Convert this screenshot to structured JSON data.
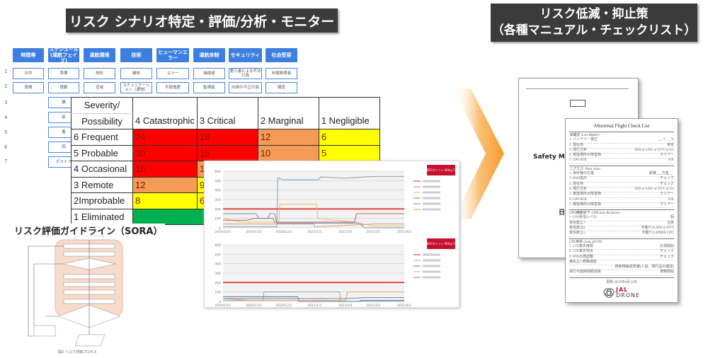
{
  "titles": {
    "left": "リスク シナリオ特定・評価/分析・モニター",
    "right_line1": "リスク低減・抑止策",
    "right_line2": "（各種マニュアル・チェックリスト）"
  },
  "categories": [
    "時間帯",
    "スケジュール\n(運航フェイズ)",
    "運航環境",
    "技術",
    "ヒューマンエラー",
    "運航体制",
    "セキュリティ",
    "社会受容"
  ],
  "row_numbers": [
    "1",
    "2",
    "3",
    "4",
    "5",
    "6",
    "7"
  ],
  "scenario_rows": [
    [
      "日中",
      "準備",
      "地形",
      "機体",
      "エラー",
      "操縦者",
      "第三者による不法行為",
      "利害関係者"
    ],
    [
      "夜間",
      "搭載",
      "空域",
      "コミュニケーション（通信）",
      "手順逸脱",
      "監視者",
      "内部の不正行為",
      "報道"
    ]
  ],
  "schedule_more": [
    "離",
    "巡",
    "着",
    "回",
    "ポストフ"
  ],
  "risk_matrix": {
    "header_top": "Severity/",
    "header_bottom": "Possibility",
    "columns": [
      "4 Catastrophic",
      "3 Critical",
      "2 Marginal",
      "1 Negligible"
    ],
    "rows": [
      {
        "label": "6 Frequent",
        "values": [
          "24",
          "18",
          "12",
          "6"
        ],
        "colors": [
          "#ff0000",
          "#ff0000",
          "#f59a57",
          "#ffff00"
        ]
      },
      {
        "label": "5 Probable",
        "values": [
          "20",
          "15",
          "10",
          "5"
        ],
        "colors": [
          "#ff0000",
          "#ff0000",
          "#f59a57",
          "#ffff00"
        ]
      },
      {
        "label": "4 Occasional",
        "values": [
          "16",
          "12",
          "",
          ""
        ],
        "colors": [
          "#ff0000",
          "#f59a57",
          "#ffffff",
          "#ffffff"
        ]
      },
      {
        "label": "3 Remote",
        "values": [
          "12",
          "9",
          "",
          ""
        ],
        "colors": [
          "#f59a57",
          "#ffff00",
          "#ffffff",
          "#ffffff"
        ]
      },
      {
        "label": "2Improbable",
        "values": [
          "8",
          "6",
          "",
          ""
        ],
        "colors": [
          "#ffff00",
          "#ffff00",
          "#ffffff",
          "#ffffff"
        ]
      },
      {
        "label": "1 Eliminated",
        "values": [
          ""
        ],
        "colors": [
          "#00b050"
        ]
      }
    ]
  },
  "sora": {
    "title": "リスク評価ガイドライン（SORA）",
    "caption": "図2 リスク評価プロセス"
  },
  "chart_data": [
    {
      "type": "line",
      "ylim": [
        0,
        600
      ],
      "yticks": [
        "0",
        "100",
        "200",
        "300",
        "400",
        "500",
        "600"
      ],
      "xticks": [
        "2020/10/1",
        "2020/11/1",
        "2020/12/1",
        "2021/1/1",
        "2021/2/1",
        "2021/3/1",
        "2021/4/1"
      ],
      "grid": true,
      "legend": "right",
      "badge": "ERCポイント 900以下",
      "series": [
        {
          "color": "#e02020",
          "points": [
            [
              "2020/10/1",
              200
            ],
            [
              "2021/4/1",
              200
            ]
          ]
        },
        {
          "color": "#8a9ab8",
          "points": [
            [
              "2020/10/1",
              10
            ],
            [
              "2020/11/24",
              10
            ],
            [
              "2020/11/25",
              530
            ],
            [
              "2020/11/30",
              510
            ],
            [
              "2021/1/5",
              510
            ],
            [
              "2021/1/7",
              540
            ],
            [
              "2021/2/1",
              525
            ],
            [
              "2021/2/20",
              540
            ],
            [
              "2021/3/5",
              545
            ],
            [
              "2021/4/1",
              545
            ]
          ]
        },
        {
          "color": "#f0c060",
          "points": [
            [
              "2020/10/1",
              100
            ],
            [
              "2020/10/20",
              60
            ],
            [
              "2020/11/26",
              60
            ],
            [
              "2020/11/27",
              250
            ],
            [
              "2021/1/3",
              250
            ],
            [
              "2021/1/4",
              100
            ],
            [
              "2021/2/10",
              60
            ],
            [
              "2021/3/1",
              20
            ],
            [
              "2021/4/1",
              20
            ]
          ]
        },
        {
          "color": "#c06060",
          "points": [
            [
              "2020/10/1",
              80
            ],
            [
              "2020/10/25",
              80
            ],
            [
              "2020/11/1",
              100
            ],
            [
              "2020/11/20",
              100
            ],
            [
              "2020/11/22",
              60
            ],
            [
              "2021/2/10",
              60
            ],
            [
              "2021/2/12",
              150
            ],
            [
              "2021/4/1",
              150
            ]
          ]
        },
        {
          "color": "#7090b0",
          "points": [
            [
              "2020/10/1",
              150
            ],
            [
              "2020/11/3",
              150
            ],
            [
              "2020/11/6",
              100
            ],
            [
              "2020/11/15",
              100
            ],
            [
              "2020/11/17",
              150
            ],
            [
              "2020/11/22",
              150
            ],
            [
              "2020/11/24",
              50
            ],
            [
              "2021/2/15",
              50
            ],
            [
              "2021/2/20",
              0
            ],
            [
              "2021/4/1",
              0
            ]
          ]
        },
        {
          "color": "#d0a070",
          "points": [
            [
              "2020/10/1",
              40
            ],
            [
              "2020/12/31",
              40
            ],
            [
              "2021/1/1",
              10
            ],
            [
              "2021/3/1",
              40
            ],
            [
              "2021/4/1",
              40
            ]
          ]
        }
      ]
    },
    {
      "type": "line",
      "ylim": [
        0,
        600
      ],
      "yticks": [
        "0",
        "100",
        "200",
        "300",
        "400",
        "500",
        "600"
      ],
      "xticks": [
        "2020/10/1",
        "2020/11/1",
        "2020/12/1",
        "2021/1/1",
        "2021/2/1",
        "2021/3/1",
        "2021/4/1"
      ],
      "grid": true,
      "legend": "right",
      "badge": "ERCポイント 900以下",
      "series": [
        {
          "color": "#e02020",
          "points": [
            [
              "2020/10/1",
              200
            ],
            [
              "2021/4/1",
              200
            ]
          ]
        },
        {
          "color": "#a0a0a0",
          "points": [
            [
              "2020/10/1",
              10
            ],
            [
              "2020/11/10",
              10
            ],
            [
              "2020/11/11",
              100
            ],
            [
              "2021/1/26",
              100
            ],
            [
              "2021/1/27",
              0
            ],
            [
              "2021/4/1",
              0
            ]
          ]
        },
        {
          "color": "#5577aa",
          "points": [
            [
              "2020/10/1",
              50
            ],
            [
              "2020/12/15",
              50
            ],
            [
              "2020/12/16",
              0
            ],
            [
              "2021/2/15",
              0
            ],
            [
              "2021/2/16",
              10
            ],
            [
              "2021/4/1",
              10
            ]
          ]
        },
        {
          "color": "#f0a060",
          "points": [
            [
              "2020/10/1",
              30
            ],
            [
              "2020/10/30",
              10
            ],
            [
              "2021/2/1",
              10
            ],
            [
              "2021/2/3",
              100
            ],
            [
              "2021/4/1",
              100
            ]
          ]
        },
        {
          "color": "#7a8aa0",
          "points": [
            [
              "2020/10/1",
              30
            ],
            [
              "2021/2/1",
              30
            ],
            [
              "2021/2/20",
              40
            ],
            [
              "2021/4/1",
              40
            ]
          ]
        }
      ]
    }
  ],
  "documents": {
    "back": {
      "title_partial": "Safety Ma",
      "footer_partial": "日本"
    },
    "checklist": {
      "title": "Abnormal Flight Check List",
      "sections": [
        {
          "heading": "低電圧 -Low Battery-",
          "items": [
            [
              "1. バッテリー電圧",
              "___V___%"
            ],
            [
              "2. 現在地",
              "特定"
            ],
            [
              "3. 飛行方針",
              "ATB or LDG or DVT or Go"
            ],
            [
              "4. 着陸場所の障害物",
              "クリアー"
            ],
            [
              "5. GPS RTK",
              "FIX"
            ]
          ]
        },
        {
          "heading": "ニアミス -Near miss-",
          "items": [
            [
              "1. 相手機の位置",
              "距離___方角___"
            ],
            [
              "2. Hold指示",
              "チェック"
            ],
            [
              "3. 現在地",
              "チェック"
            ],
            [
              "4. 飛行方針",
              "ATB or LDG or DVT or Go"
            ],
            [
              "5. 着陸場所の障害物",
              "クリアー"
            ],
            [
              "6. GPS RTK",
              "FIX"
            ],
            [
              "7. 着陸場所の障害物",
              "クリアー"
            ]
          ]
        },
        {
          "heading": "GPS精度低下 -GPS Low Accuracy-",
          "items": [
            [
              "1. GPS受信レベル",
              "個"
            ],
            [
              "受信数≧7",
              "注意"
            ],
            [
              "受信数≦6",
              "手動介入ATB or DVT"
            ],
            [
              "受信数≦5",
              "手動介入EMER LDG"
            ]
          ]
        },
        {
          "heading": "LTE喪失 -Loss of LTE-",
          "items": [
            [
              "1. LTE喪失時間",
              "計測開始"
            ],
            [
              "2. LTE喪失地点",
              "チェック"
            ],
            [
              "3. POSの再起動",
              "チェック"
            ],
            [
              "喪失≧1 経路通過",
              ""
            ],
            [
              "",
              "捜索隊編成準備(人員、飛行品の確認)"
            ],
            [
              "飛行可能時間経過後",
              "捜索開始"
            ]
          ]
        }
      ],
      "updated": "更新 2022年8月12日",
      "logo_top": "JAL",
      "logo_bottom": "DRONE"
    }
  },
  "colors": {
    "title_bg": "#3b3b3b",
    "category_blue": "#3d7fe0",
    "arrow_orange": "#f7a23a",
    "threshold_red": "#e02020",
    "badge_red": "#c8102e",
    "sora_fill": "#f8dccb"
  }
}
